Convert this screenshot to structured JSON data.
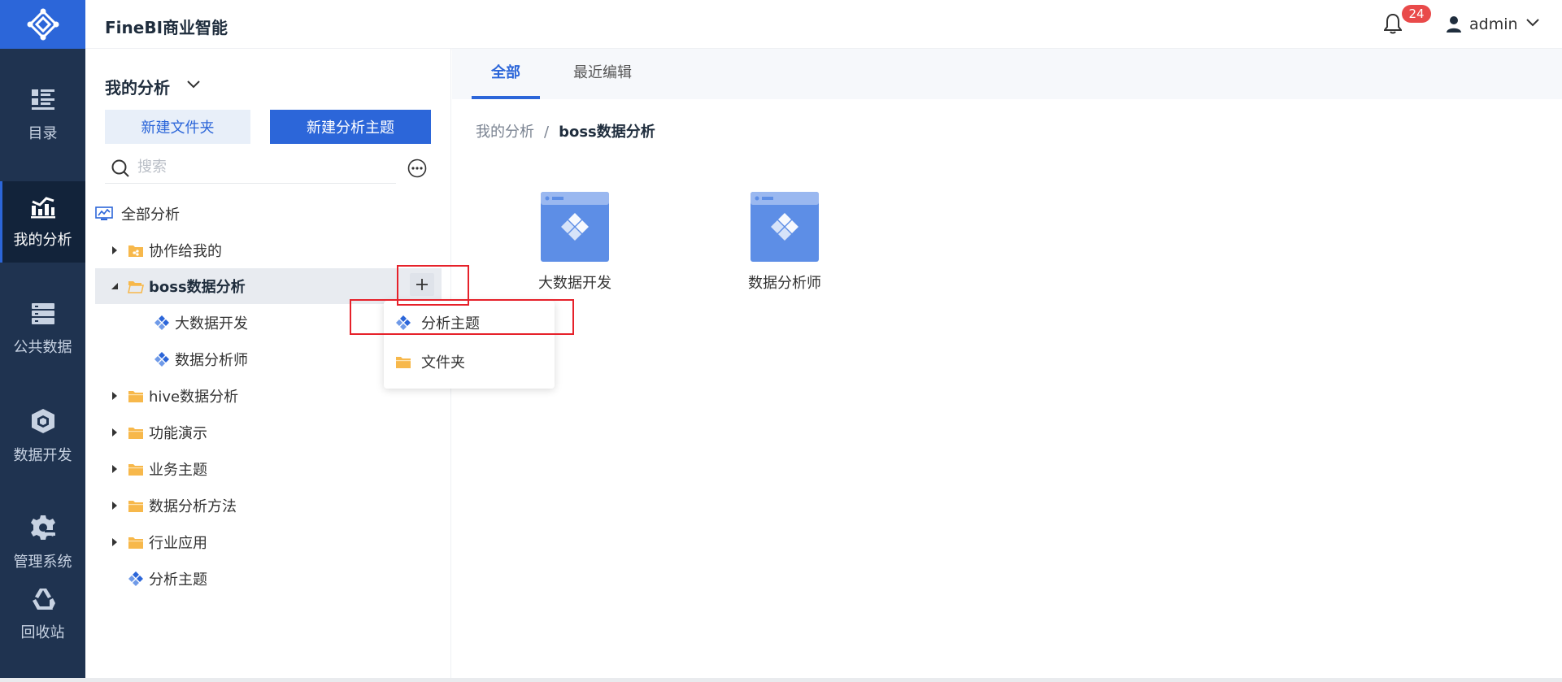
{
  "header": {
    "app_title": "FineBI商业智能",
    "notification_count": "24",
    "user_name": "admin"
  },
  "nav": {
    "items": [
      {
        "label": "目录",
        "icon": "catalog-icon"
      },
      {
        "label": "我的分析",
        "icon": "chart-analysis-icon",
        "active": true
      },
      {
        "label": "公共数据",
        "icon": "database-icon"
      },
      {
        "label": "数据开发",
        "icon": "cube-icon"
      },
      {
        "label": "管理系统",
        "icon": "gear-icon"
      },
      {
        "label": "回收站",
        "icon": "recycle-icon"
      }
    ]
  },
  "panel": {
    "title": "我的分析",
    "new_folder_label": "新建文件夹",
    "new_subject_label": "新建分析主题",
    "search_placeholder": "搜索",
    "tree": [
      {
        "label": "全部分析",
        "type": "root"
      },
      {
        "label": "协作给我的",
        "type": "shared-folder",
        "expanded": false
      },
      {
        "label": "boss数据分析",
        "type": "folder",
        "expanded": true,
        "selected": true
      },
      {
        "label": "大数据开发",
        "type": "subject",
        "child": true
      },
      {
        "label": "数据分析师",
        "type": "subject",
        "child": true
      },
      {
        "label": "hive数据分析",
        "type": "folder",
        "expanded": false
      },
      {
        "label": "功能演示",
        "type": "folder",
        "expanded": false
      },
      {
        "label": "业务主题",
        "type": "folder",
        "expanded": false
      },
      {
        "label": "数据分析方法",
        "type": "folder",
        "expanded": false
      },
      {
        "label": "行业应用",
        "type": "folder",
        "expanded": false
      },
      {
        "label": "分析主题",
        "type": "subject"
      }
    ]
  },
  "dropdown": {
    "items": [
      {
        "label": "分析主题",
        "icon": "subject-icon"
      },
      {
        "label": "文件夹",
        "icon": "folder-icon"
      }
    ]
  },
  "main": {
    "tabs": [
      {
        "label": "全部",
        "active": true
      },
      {
        "label": "最近编辑",
        "active": false
      }
    ],
    "breadcrumb": {
      "root": "我的分析",
      "separator": "/",
      "current": "boss数据分析"
    },
    "cards": [
      {
        "label": "大数据开发"
      },
      {
        "label": "数据分析师"
      }
    ]
  },
  "colors": {
    "brand": "#2c66d9",
    "nav_bg": "#1f3350",
    "highlight": "#e6212a",
    "badge": "#e94a4a",
    "folder": "#f7b84b"
  }
}
